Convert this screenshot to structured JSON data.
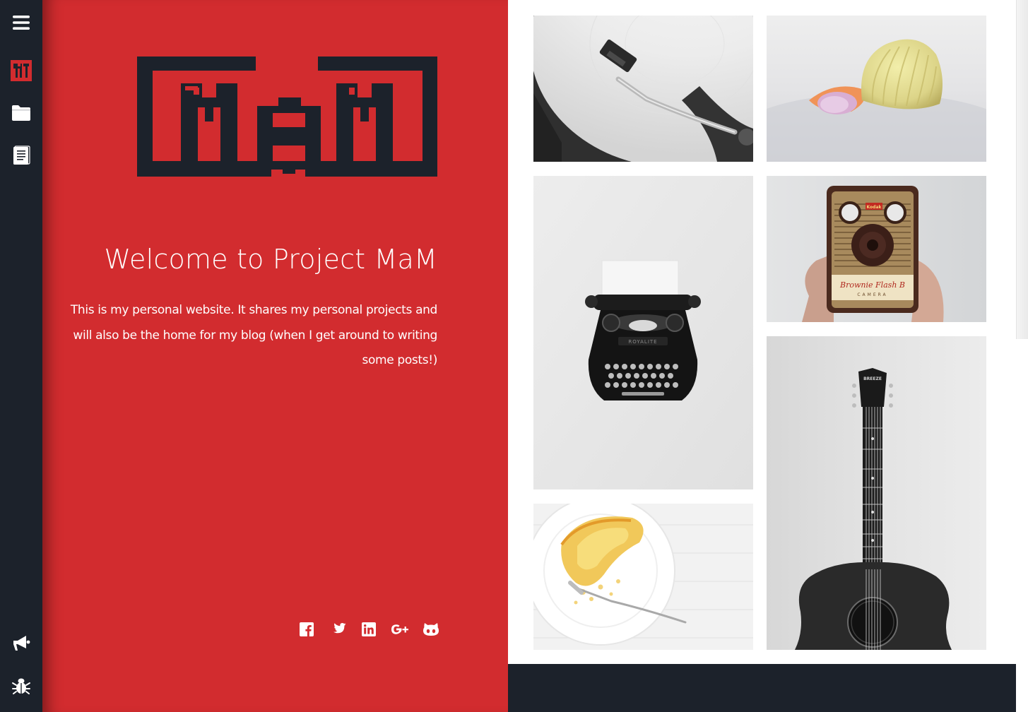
{
  "sidebar": {
    "items": [
      {
        "icon": "menu-icon",
        "label": ""
      },
      {
        "icon": "mam-logo-icon",
        "label": ""
      },
      {
        "icon": "folder-icon",
        "label": ""
      },
      {
        "icon": "document-icon",
        "label": ""
      }
    ],
    "bottom_items": [
      {
        "icon": "megaphone-icon",
        "label": ""
      },
      {
        "icon": "bug-icon",
        "label": ""
      }
    ]
  },
  "hero": {
    "logo_text": "MaM",
    "title": "Welcome to Project MaM",
    "description": "This is my personal website. It shares my personal projects and will also be the home for my blog (when I get around to writing some posts!)",
    "socials": [
      "facebook-icon",
      "twitter-icon",
      "linkedin-icon",
      "google-plus-icon",
      "github-icon"
    ]
  },
  "gallery": {
    "tiles": [
      {
        "subject": "record-player"
      },
      {
        "subject": "seashells"
      },
      {
        "subject": "typewriter",
        "brand_text": "ROYALITE"
      },
      {
        "subject": "camera",
        "brand_text": "Kodak",
        "model_text": "Brownie Flash B",
        "sub_text": "CAMERA"
      },
      {
        "subject": "guitar",
        "brand_text": "BREEZE"
      },
      {
        "subject": "cake-plate"
      }
    ]
  },
  "colors": {
    "sidebar_bg": "#1c222b",
    "hero_bg": "#d22c2f",
    "accent": "#d22c2f",
    "text_light": "#ffffff"
  }
}
